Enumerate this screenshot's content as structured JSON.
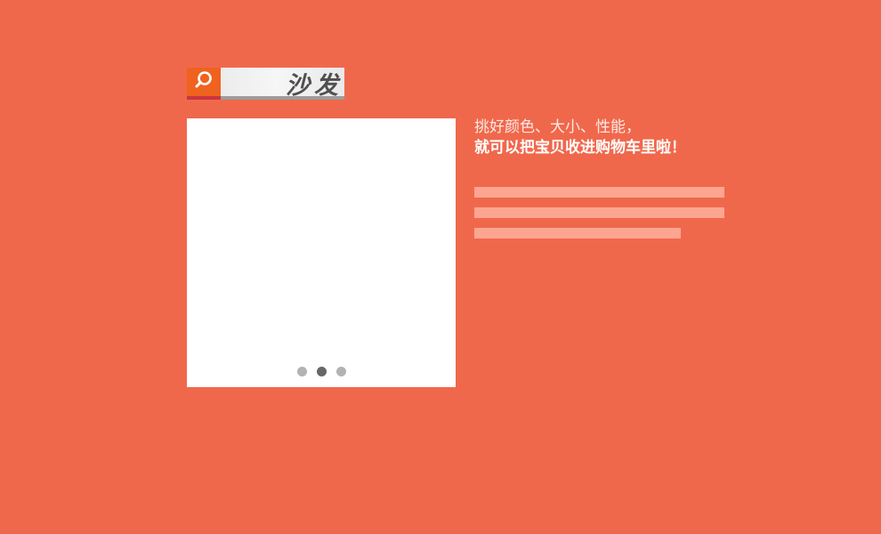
{
  "search": {
    "icon": "search-icon",
    "query": "沙发"
  },
  "product": {
    "carousel": {
      "total_slides": 3,
      "active_index": 1
    }
  },
  "copy": {
    "line1": "挑好颜色、大小、性能，",
    "line2": "就可以把宝贝收进购物车里啦！"
  },
  "colors": {
    "background": "#f0684c",
    "search_accent": "#f0621f",
    "placeholder_bar": "#fca590",
    "dot_active": "#676767",
    "dot_inactive": "#b3b3b3"
  }
}
